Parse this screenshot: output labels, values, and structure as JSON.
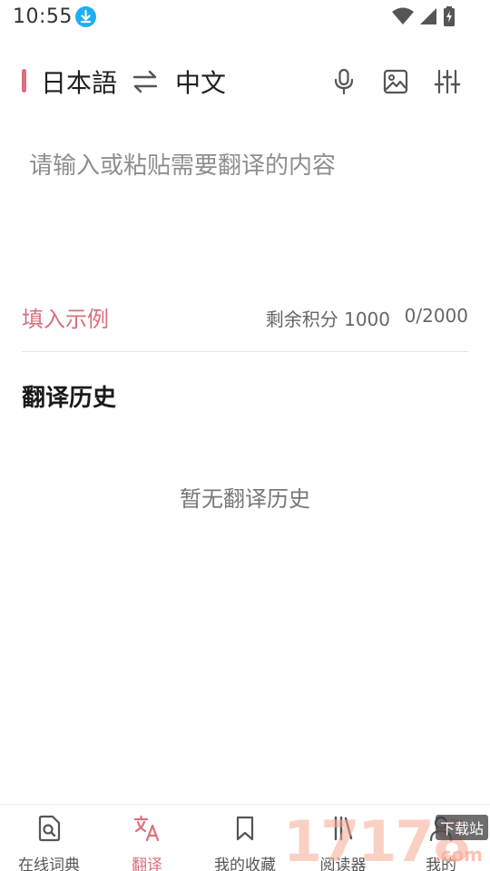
{
  "status_bar": {
    "time": "10:55",
    "download_icon": "download-icon",
    "wifi_icon": "wifi-icon",
    "signal_icon": "signal-icon",
    "battery_icon": "battery-charging-icon"
  },
  "language_bar": {
    "source_language": "日本語",
    "swap_icon": "swap-icon",
    "target_language": "中文",
    "tools": [
      "microphone-icon",
      "image-icon",
      "sliders-icon"
    ]
  },
  "input": {
    "placeholder": "请输入或粘贴需要翻译的内容"
  },
  "input_footer": {
    "fill_example_label": "填入示例",
    "credits_text": "剩余积分 1000",
    "char_count": "0/2000"
  },
  "history": {
    "title": "翻译历史",
    "empty_text": "暂无翻译历史"
  },
  "bottom_nav": {
    "items": [
      {
        "label": "在线词典",
        "icon": "dictionary-search-icon"
      },
      {
        "label": "翻译",
        "icon": "translate-icon"
      },
      {
        "label": "我的收藏",
        "icon": "bookmark-icon"
      },
      {
        "label": "阅读器",
        "icon": "reader-icon"
      },
      {
        "label": "我的",
        "icon": "profile-icon"
      }
    ],
    "active_label": "翻译"
  },
  "watermark": {
    "digits": "17178",
    "tag": "下载站",
    "suffix": ".com"
  },
  "colors": {
    "accent": "#d96f7d",
    "placeholder": "#8e8e8e",
    "download_badge": "#1faef5"
  }
}
